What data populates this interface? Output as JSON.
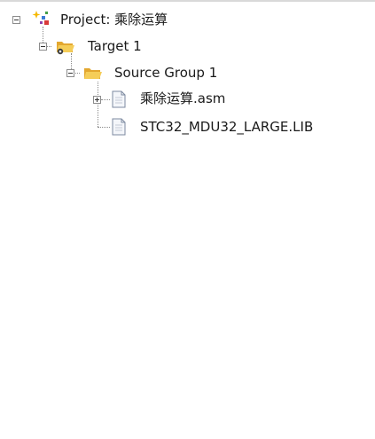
{
  "tree": {
    "project": {
      "label": "Project: 乘除运算",
      "expanded": true
    },
    "target": {
      "label": "Target 1",
      "expanded": true
    },
    "group": {
      "label": "Source Group 1",
      "expanded": true
    },
    "files": [
      {
        "label": "乘除运算.asm",
        "expandable": true,
        "expanded": false
      },
      {
        "label": "STC32_MDU32_LARGE.LIB",
        "expandable": false
      }
    ]
  },
  "icons": {
    "project": "project-sparkle-icon",
    "target": "target-folder-icon",
    "group": "folder-open-icon",
    "file": "document-icon"
  },
  "colors": {
    "background": "#ffffff",
    "text": "#1a1a1a",
    "connector": "#8a8a8a",
    "folder": "#f2c14e"
  }
}
